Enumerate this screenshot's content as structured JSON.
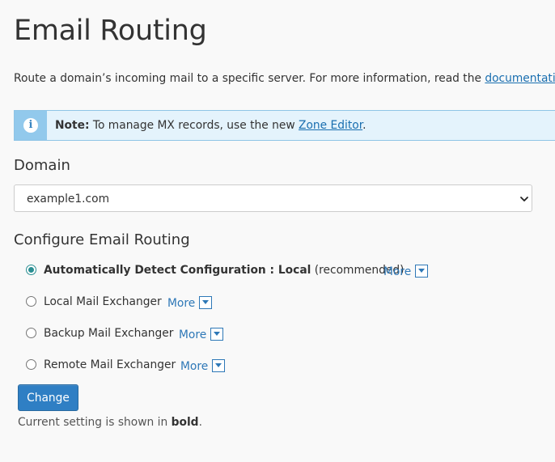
{
  "page": {
    "title": "Email Routing"
  },
  "intro": {
    "text": "Route a domain’s incoming mail to a specific server. For more information, read the ",
    "link_text": "documentation",
    "suffix": "."
  },
  "note": {
    "icon": "info-icon",
    "icon_glyph": "i",
    "label": "Note:",
    "text": " To manage MX records, use the new ",
    "link_text": "Zone Editor",
    "suffix": "."
  },
  "domain": {
    "label": "Domain",
    "selected": "example1.com"
  },
  "routing": {
    "label": "Configure Email Routing",
    "more_label": "More",
    "options": [
      {
        "label_bold": "Automatically Detect Configuration : Local",
        "label_rest": " (recommended)",
        "checked": true
      },
      {
        "label_bold": "",
        "label_rest": "Local Mail Exchanger",
        "checked": false
      },
      {
        "label_bold": "",
        "label_rest": "Backup Mail Exchanger",
        "checked": false
      },
      {
        "label_bold": "",
        "label_rest": "Remote Mail Exchanger",
        "checked": false
      }
    ]
  },
  "actions": {
    "change_label": "Change"
  },
  "footnote": {
    "prefix": "Current setting is shown in ",
    "bold": "bold",
    "suffix": "."
  },
  "colors": {
    "accent": "#2f7fc4",
    "link": "#1a6fb0",
    "note_background": "#e4f3fc",
    "note_icon_background": "#92c9ec",
    "radio_checked": "#2a8e92"
  }
}
